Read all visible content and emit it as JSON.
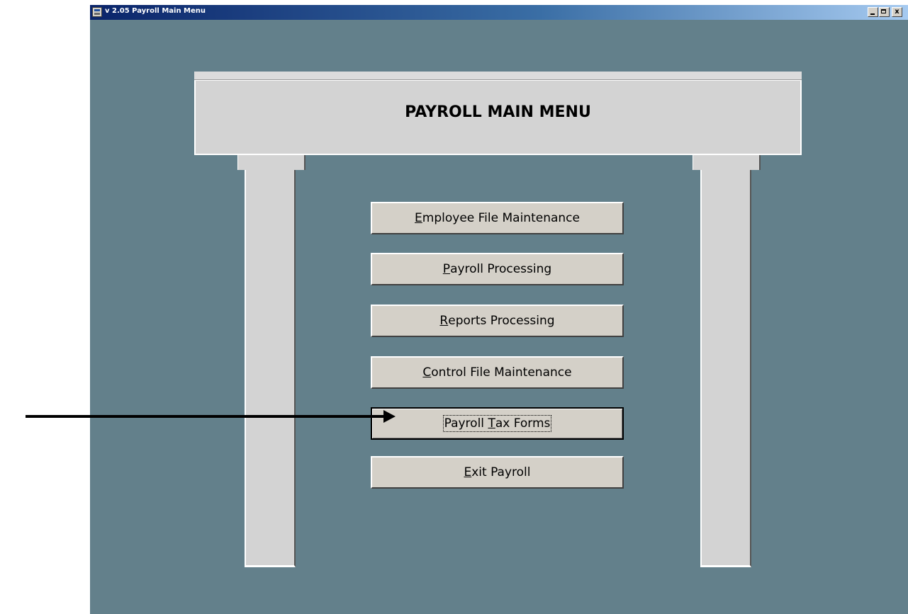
{
  "window": {
    "title": "v 2.05 Payroll Main Menu",
    "controls": {
      "minimize": "_",
      "maximize": "□",
      "close": "x"
    }
  },
  "header": {
    "title": "PAYROLL MAIN MENU"
  },
  "menu": {
    "items": [
      {
        "mnemonic": "E",
        "rest": "mployee File Maintenance",
        "prefix": ""
      },
      {
        "mnemonic": "P",
        "rest": "ayroll Processing",
        "prefix": ""
      },
      {
        "mnemonic": "R",
        "rest": "eports Processing",
        "prefix": ""
      },
      {
        "mnemonic": "C",
        "rest": "ontrol File Maintenance",
        "prefix": ""
      },
      {
        "prefix": "Payroll ",
        "mnemonic": "T",
        "rest": "ax Forms",
        "focused": true
      },
      {
        "mnemonic": "E",
        "rest": "xit Payroll",
        "prefix": ""
      }
    ]
  },
  "colors": {
    "background": "#63808b",
    "arch": "#d3d3d3",
    "button_face": "#d4d0c8",
    "title_bar_start": "#0a246a",
    "title_bar_end": "#a6caf0"
  }
}
